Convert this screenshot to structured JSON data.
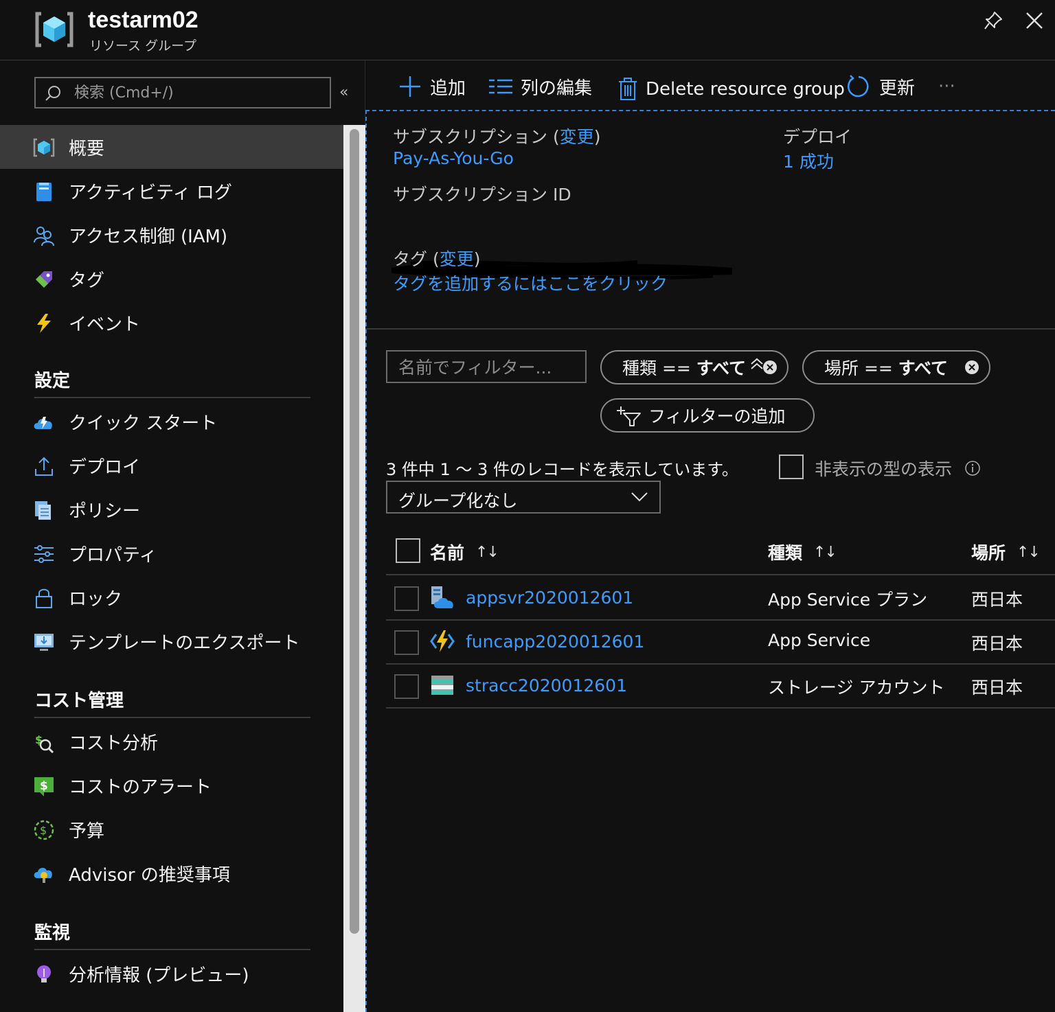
{
  "header": {
    "title": "testarm02",
    "subtitle": "リソース グループ",
    "icon": "resource-group-icon"
  },
  "sidebar": {
    "search_placeholder": "検索 (Cmd+/)",
    "collapse_glyph": "«",
    "top_items": [
      {
        "label": "概要",
        "icon": "overview-icon",
        "active": true
      },
      {
        "label": "アクティビティ ログ",
        "icon": "activity-log-icon"
      },
      {
        "label": "アクセス制御 (IAM)",
        "icon": "iam-icon"
      },
      {
        "label": "タグ",
        "icon": "tag-icon"
      },
      {
        "label": "イベント",
        "icon": "lightning-icon"
      }
    ],
    "sections": [
      {
        "title": "設定",
        "items": [
          {
            "label": "クイック スタート",
            "icon": "quickstart-cloud-icon"
          },
          {
            "label": "デプロイ",
            "icon": "deploy-upload-icon"
          },
          {
            "label": "ポリシー",
            "icon": "policy-icon"
          },
          {
            "label": "プロパティ",
            "icon": "properties-sliders-icon"
          },
          {
            "label": "ロック",
            "icon": "lock-icon"
          },
          {
            "label": "テンプレートのエクスポート",
            "icon": "export-template-icon"
          }
        ]
      },
      {
        "title": "コスト管理",
        "items": [
          {
            "label": "コスト分析",
            "icon": "cost-analysis-icon"
          },
          {
            "label": "コストのアラート",
            "icon": "cost-alert-icon"
          },
          {
            "label": "予算",
            "icon": "budget-icon"
          },
          {
            "label": "Advisor の推奨事項",
            "icon": "advisor-icon"
          }
        ]
      },
      {
        "title": "監視",
        "items": [
          {
            "label": "分析情報 (プレビュー)",
            "icon": "insights-bulb-icon"
          }
        ]
      }
    ]
  },
  "toolbar": {
    "add": "追加",
    "edit_columns": "列の編集",
    "delete": "Delete resource group",
    "refresh": "更新",
    "more": "···"
  },
  "essentials": {
    "subscription_label": "サブスクリプション",
    "change_link": "変更",
    "subscription_value": "Pay-As-You-Go",
    "deploy_label": "デプロイ",
    "deploy_value": "1 成功",
    "subscription_id_label": "サブスクリプション ID",
    "tags_label": "タグ",
    "tags_link": "タグを追加するにはここをクリック"
  },
  "filters": {
    "name_placeholder": "名前でフィルター...",
    "type_key": "種類 ==",
    "type_value": "すべて",
    "location_key": "場所 ==",
    "location_value": "すべて",
    "add_filter": "フィルターの追加"
  },
  "records": {
    "count_text": "3 件中 1 〜 3 件のレコードを表示しています。",
    "show_hidden_label": "非表示の型の表示",
    "grouping_value": "グループ化なし"
  },
  "table": {
    "columns": {
      "name": "名前",
      "type": "種類",
      "location": "場所",
      "sort_glyph": "↑↓"
    },
    "rows": [
      {
        "name": "appsvr2020012601",
        "type": "App Service プラン",
        "location": "西日本",
        "icon": "app-service-plan-icon"
      },
      {
        "name": "funcapp2020012601",
        "type": "App Service",
        "location": "西日本",
        "icon": "function-app-icon"
      },
      {
        "name": "stracc2020012601",
        "type": "ストレージ アカウント",
        "location": "西日本",
        "icon": "storage-account-icon"
      }
    ]
  },
  "colors": {
    "accent": "#3b9cff",
    "background": "#111111",
    "active_item": "#3a3a3a"
  }
}
